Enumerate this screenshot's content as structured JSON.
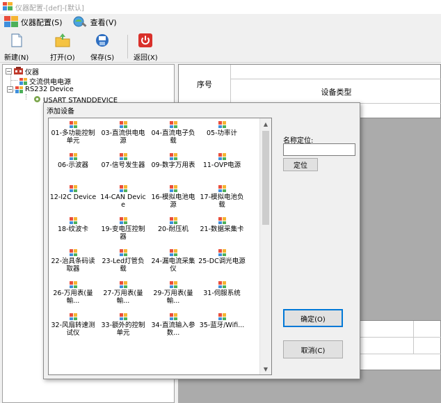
{
  "window": {
    "title": "仪器配置-[def]-[默认]"
  },
  "menu": [
    {
      "label": "仪器配置(S)",
      "icon": "instrument-config-icon"
    },
    {
      "label": "查看(V)",
      "icon": "view-icon"
    }
  ],
  "toolbar": {
    "new_label": "新建(N)",
    "open_label": "打开(O)",
    "save_label": "保存(S)",
    "return_label": "返回(X)"
  },
  "tree": {
    "root": "仪器",
    "items": [
      {
        "label": "交流供电电源"
      },
      {
        "label": "RS232 Device"
      },
      {
        "label": "USART STANDDEVICE"
      }
    ]
  },
  "grid": {
    "col_index": "序号",
    "col_type": "设备类型"
  },
  "dialog": {
    "title": "添加设备",
    "name_locate_label": "名称定位:",
    "name_locate_value": "",
    "locate_button": "定位",
    "ok_button": "确定(O)",
    "cancel_button": "取消(C)",
    "devices": [
      "01-多功能控制单元",
      "03-直流供电电源",
      "04-直流电子负载",
      "05-功率计",
      "06-示波器",
      "07-信号发生器",
      "09-数字万用表",
      "11-OVP电源",
      "12-I2C Device",
      "14-CAN Device",
      "16-模拟电池电源",
      "17-模拟电池负载",
      "18-纹波卡",
      "19-变电压控制器",
      "20-耐压机",
      "21-数据采集卡",
      "22-治具条码读取器",
      "23-Led灯管负载",
      "24-漏电流采集仪",
      "25-DC调光电源",
      "26-万用表(量輸...",
      "27-万用表(量輸...",
      "29-万用表(量輸...",
      "31-伺服系统",
      "32-风扇转速测试仪",
      "33-额外的控制单元",
      "34-直流输入参数...",
      "35-蓝牙/Wifi..."
    ]
  }
}
